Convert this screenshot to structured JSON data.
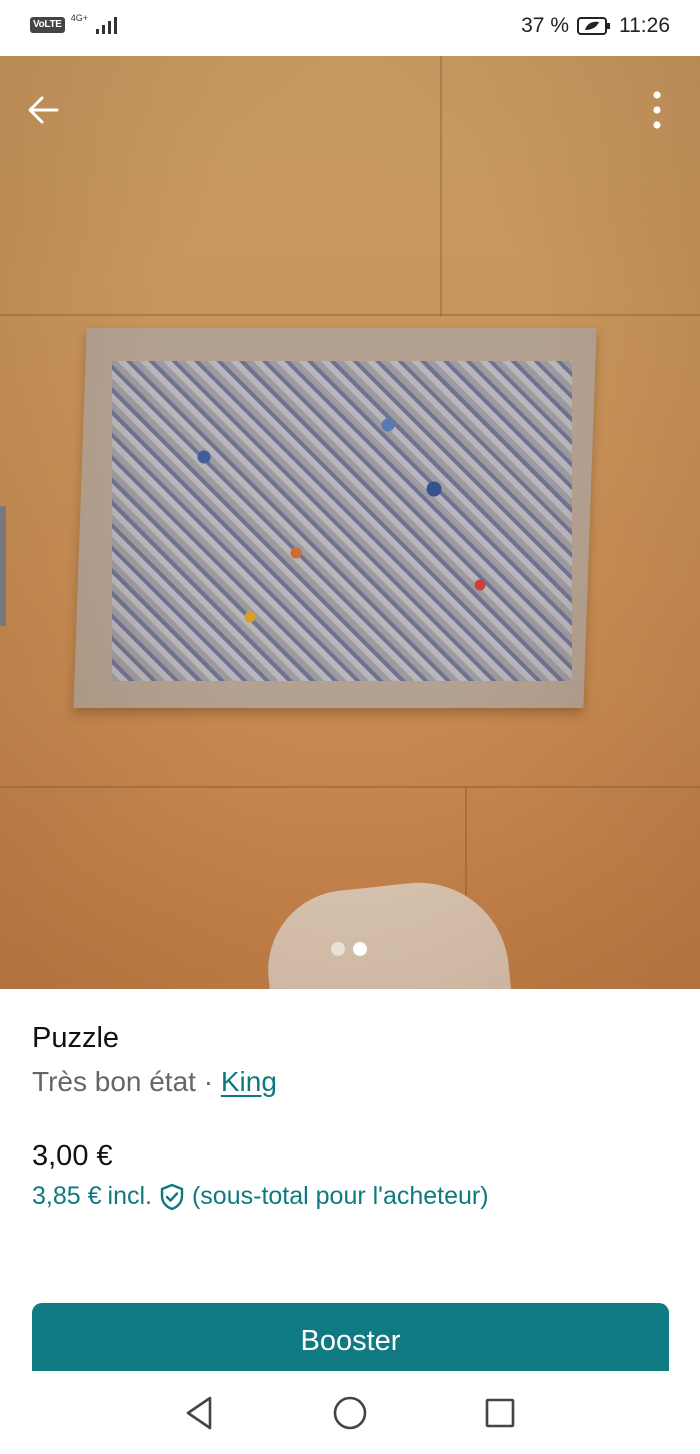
{
  "status_bar": {
    "network_badge": "VoLTE",
    "network_type": "4G+",
    "battery_percent": "37 %",
    "time": "11:26"
  },
  "gallery": {
    "current_index": 2,
    "total_images": 2,
    "icons": {
      "back": "arrow-left-icon",
      "more": "more-vertical-icon"
    }
  },
  "listing": {
    "title": "Puzzle",
    "condition": "Très bon état",
    "separator": " · ",
    "brand": "King",
    "price": "3,00 €",
    "total_price": "3,85 €",
    "total_incl": "incl.",
    "total_note": "(sous-total pour l'acheteur)"
  },
  "actions": {
    "booster_label": "Booster"
  },
  "colors": {
    "accent": "#0f7a82",
    "link": "#0e7a80"
  },
  "nav_icons": [
    "back-triangle-icon",
    "home-circle-icon",
    "recents-square-icon"
  ]
}
